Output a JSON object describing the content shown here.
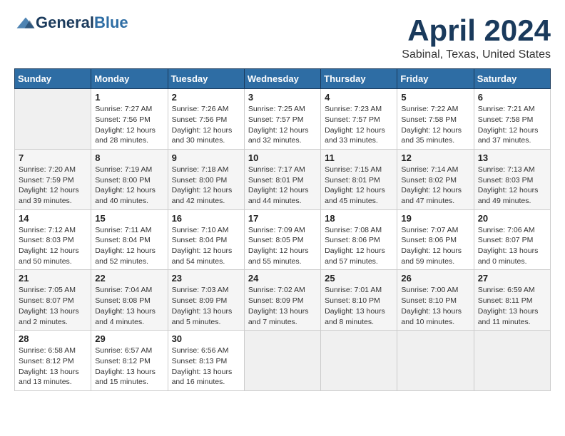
{
  "header": {
    "logo_general": "General",
    "logo_blue": "Blue",
    "title": "April 2024",
    "location": "Sabinal, Texas, United States"
  },
  "calendar": {
    "days_of_week": [
      "Sunday",
      "Monday",
      "Tuesday",
      "Wednesday",
      "Thursday",
      "Friday",
      "Saturday"
    ],
    "weeks": [
      [
        {
          "day": "",
          "info": ""
        },
        {
          "day": "1",
          "info": "Sunrise: 7:27 AM\nSunset: 7:56 PM\nDaylight: 12 hours\nand 28 minutes."
        },
        {
          "day": "2",
          "info": "Sunrise: 7:26 AM\nSunset: 7:56 PM\nDaylight: 12 hours\nand 30 minutes."
        },
        {
          "day": "3",
          "info": "Sunrise: 7:25 AM\nSunset: 7:57 PM\nDaylight: 12 hours\nand 32 minutes."
        },
        {
          "day": "4",
          "info": "Sunrise: 7:23 AM\nSunset: 7:57 PM\nDaylight: 12 hours\nand 33 minutes."
        },
        {
          "day": "5",
          "info": "Sunrise: 7:22 AM\nSunset: 7:58 PM\nDaylight: 12 hours\nand 35 minutes."
        },
        {
          "day": "6",
          "info": "Sunrise: 7:21 AM\nSunset: 7:58 PM\nDaylight: 12 hours\nand 37 minutes."
        }
      ],
      [
        {
          "day": "7",
          "info": "Sunrise: 7:20 AM\nSunset: 7:59 PM\nDaylight: 12 hours\nand 39 minutes."
        },
        {
          "day": "8",
          "info": "Sunrise: 7:19 AM\nSunset: 8:00 PM\nDaylight: 12 hours\nand 40 minutes."
        },
        {
          "day": "9",
          "info": "Sunrise: 7:18 AM\nSunset: 8:00 PM\nDaylight: 12 hours\nand 42 minutes."
        },
        {
          "day": "10",
          "info": "Sunrise: 7:17 AM\nSunset: 8:01 PM\nDaylight: 12 hours\nand 44 minutes."
        },
        {
          "day": "11",
          "info": "Sunrise: 7:15 AM\nSunset: 8:01 PM\nDaylight: 12 hours\nand 45 minutes."
        },
        {
          "day": "12",
          "info": "Sunrise: 7:14 AM\nSunset: 8:02 PM\nDaylight: 12 hours\nand 47 minutes."
        },
        {
          "day": "13",
          "info": "Sunrise: 7:13 AM\nSunset: 8:03 PM\nDaylight: 12 hours\nand 49 minutes."
        }
      ],
      [
        {
          "day": "14",
          "info": "Sunrise: 7:12 AM\nSunset: 8:03 PM\nDaylight: 12 hours\nand 50 minutes."
        },
        {
          "day": "15",
          "info": "Sunrise: 7:11 AM\nSunset: 8:04 PM\nDaylight: 12 hours\nand 52 minutes."
        },
        {
          "day": "16",
          "info": "Sunrise: 7:10 AM\nSunset: 8:04 PM\nDaylight: 12 hours\nand 54 minutes."
        },
        {
          "day": "17",
          "info": "Sunrise: 7:09 AM\nSunset: 8:05 PM\nDaylight: 12 hours\nand 55 minutes."
        },
        {
          "day": "18",
          "info": "Sunrise: 7:08 AM\nSunset: 8:06 PM\nDaylight: 12 hours\nand 57 minutes."
        },
        {
          "day": "19",
          "info": "Sunrise: 7:07 AM\nSunset: 8:06 PM\nDaylight: 12 hours\nand 59 minutes."
        },
        {
          "day": "20",
          "info": "Sunrise: 7:06 AM\nSunset: 8:07 PM\nDaylight: 13 hours\nand 0 minutes."
        }
      ],
      [
        {
          "day": "21",
          "info": "Sunrise: 7:05 AM\nSunset: 8:07 PM\nDaylight: 13 hours\nand 2 minutes."
        },
        {
          "day": "22",
          "info": "Sunrise: 7:04 AM\nSunset: 8:08 PM\nDaylight: 13 hours\nand 4 minutes."
        },
        {
          "day": "23",
          "info": "Sunrise: 7:03 AM\nSunset: 8:09 PM\nDaylight: 13 hours\nand 5 minutes."
        },
        {
          "day": "24",
          "info": "Sunrise: 7:02 AM\nSunset: 8:09 PM\nDaylight: 13 hours\nand 7 minutes."
        },
        {
          "day": "25",
          "info": "Sunrise: 7:01 AM\nSunset: 8:10 PM\nDaylight: 13 hours\nand 8 minutes."
        },
        {
          "day": "26",
          "info": "Sunrise: 7:00 AM\nSunset: 8:10 PM\nDaylight: 13 hours\nand 10 minutes."
        },
        {
          "day": "27",
          "info": "Sunrise: 6:59 AM\nSunset: 8:11 PM\nDaylight: 13 hours\nand 11 minutes."
        }
      ],
      [
        {
          "day": "28",
          "info": "Sunrise: 6:58 AM\nSunset: 8:12 PM\nDaylight: 13 hours\nand 13 minutes."
        },
        {
          "day": "29",
          "info": "Sunrise: 6:57 AM\nSunset: 8:12 PM\nDaylight: 13 hours\nand 15 minutes."
        },
        {
          "day": "30",
          "info": "Sunrise: 6:56 AM\nSunset: 8:13 PM\nDaylight: 13 hours\nand 16 minutes."
        },
        {
          "day": "",
          "info": ""
        },
        {
          "day": "",
          "info": ""
        },
        {
          "day": "",
          "info": ""
        },
        {
          "day": "",
          "info": ""
        }
      ]
    ]
  }
}
